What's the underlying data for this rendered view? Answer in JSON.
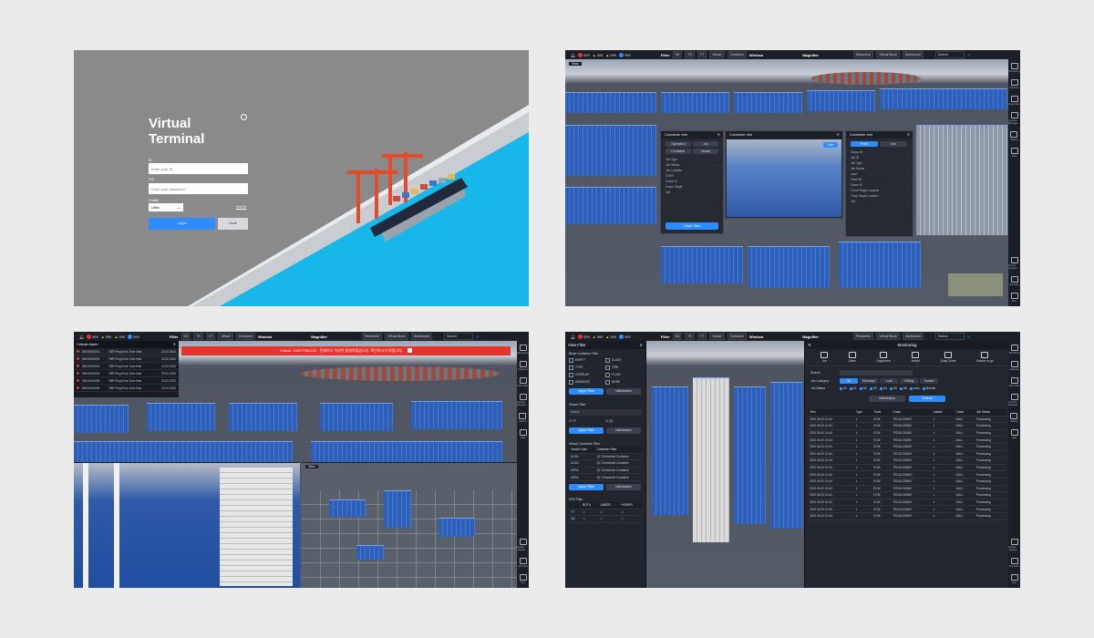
{
  "login": {
    "title_line1": "Virtual",
    "title_line2": "Terminal",
    "id_label": "ID",
    "id_placeholder": "Enter your ID",
    "pw_label": "PW",
    "pw_placeholder": "Enter your password",
    "quality_label": "Quality",
    "quality_value": "Ultra",
    "find_id": "Find ID",
    "login_button": "Log In",
    "close_button": "Close"
  },
  "toolbar": {
    "counts": [
      "999",
      "999",
      "999",
      "999"
    ],
    "filter_label": "Filter",
    "filter_items": [
      "SD",
      "TS",
      "YT"
    ],
    "vessel": "Vessel",
    "container": "Container",
    "window_label": "Window",
    "magnifier": "Magnifier",
    "right_items": [
      "Restorefor",
      "Virtual Block",
      "Dashboard"
    ],
    "search": "Search"
  },
  "sidebar": [
    "Monitoring",
    "Captures",
    "View Filter",
    "Camera Manager",
    "Setting",
    "Help",
    "Screen Capture",
    "Overview",
    "Exit"
  ],
  "panel2": {
    "view_label": "View",
    "dlg1": {
      "title": "Container Info",
      "tabs": [
        "Operation",
        "Job",
        "Container",
        "Vessel"
      ],
      "rows": [
        "Job Type",
        "Job Status",
        "Job Location",
        "CNTR",
        "Crane ID",
        "Crane Target",
        "Job"
      ],
      "button": "Driver View"
    },
    "dlg2": {
      "title": "Container Info",
      "button": "Live"
    },
    "dlg3": {
      "title": "Container Info",
      "tabs": [
        "Point",
        "Info"
      ],
      "rows": [
        "Group ID",
        "Job ID",
        "Job Type",
        "Job Status",
        "Lane",
        "Truck ID",
        "Crane ID",
        "Crane Target Location",
        "Truck Target Location",
        "Job"
      ]
    }
  },
  "panel3": {
    "alarm_title": "Critical Alarm",
    "alarms": [
      {
        "id": "DBG0000001",
        "msg": "TBR Ping Error Over time",
        "time": "22.02.2022"
      },
      {
        "id": "DBG0000002",
        "msg": "TBR Ping Error Over time",
        "time": "22.02.2022"
      },
      {
        "id": "DBG0000003",
        "msg": "TBR Ping Error Over time",
        "time": "22.02.2022"
      },
      {
        "id": "DBG0000004",
        "msg": "TBR Ping Error Over time",
        "time": "22.02.2022"
      },
      {
        "id": "DBG0000005",
        "msg": "TBR Ping Error Over time",
        "time": "22.02.2022"
      },
      {
        "id": "DBG0000006",
        "msg": "TBR Ping Error Over time",
        "time": "22.02.2022"
      }
    ],
    "banner": "Critical : DBVTR80222 - 컨테이너 이상이 발생하였습니다. 확인하시기 바랍니다."
  },
  "panel4": {
    "filter_title": "View Filter",
    "block_filter": "Block Container Filter",
    "block_items": [
      "EMPTY",
      "CLASS",
      "TYPE",
      "TIER",
      "OVERLAP",
      "FLOAT",
      "DAMAGED",
      "NONE"
    ],
    "apply": "Apply Filter",
    "init": "Initialization",
    "vessel_filter": "Vessel Filter",
    "vessel_select": "Select",
    "vessel_items": [
      "YT",
      "QC"
    ],
    "vcf_title": "Vessel Container Filter",
    "vcf_head": [
      "Vessel Code",
      "Container Filter"
    ],
    "vcf_rows": [
      [
        "ACAD",
        "QC Scheduled Container"
      ],
      [
        "ACAD",
        "QC Scheduled Container"
      ],
      [
        "AKRA",
        "QC Scheduled Container"
      ],
      [
        "AKRA",
        "QC Scheduled Container"
      ]
    ],
    "hpk_title": "HPK Filter",
    "hpk_cols": [
      "BOTH",
      "UNDER",
      "HIGHER"
    ],
    "hpk_rows": [
      "YT",
      "QC"
    ],
    "monitor_title": "Monitoring",
    "monitor_tabs": [
      "Job",
      "Alarm",
      "Equipment",
      "Vessel",
      "Quay Crane",
      "Monitor to go"
    ],
    "search_label": "Search",
    "job_category_label": "Job Category",
    "job_status_label": "Job Status",
    "categories": [
      "All",
      "Discharge",
      "Load",
      "Shifting",
      "Transfer"
    ],
    "statuses": [
      "All",
      "N1",
      "N2",
      "N3",
      "N4",
      "N5",
      "N6",
      "Auto",
      "Manual"
    ],
    "initialize": "Initialization",
    "search_button": "Search",
    "table_head": [
      "Time",
      "Type",
      "Truck",
      "Crane",
      "Ladder",
      "Crane",
      "Job Status"
    ],
    "rows": [
      [
        "2022.06.20 10:44",
        "L",
        "ECM",
        "TEDU1234567",
        "L",
        "NULL",
        "Processing"
      ],
      [
        "2022.06.20 10:44",
        "L",
        "ECM",
        "TEDU1234567",
        "L",
        "NULL",
        "Processing"
      ],
      [
        "2022.06.20 10:44",
        "L",
        "ECM",
        "TEDU1234567",
        "L",
        "NULL",
        "Processing"
      ],
      [
        "2022.06.20 10:44",
        "L",
        "ECM",
        "TEDU1234567",
        "L",
        "NULL",
        "Processing"
      ],
      [
        "2022.06.20 10:44",
        "L",
        "ECM",
        "TEDU1234567",
        "L",
        "NULL",
        "Processing"
      ],
      [
        "2022.06.20 10:44",
        "L",
        "ECM",
        "TEDU1234567",
        "L",
        "NULL",
        "Processing"
      ],
      [
        "2022.06.20 10:44",
        "L",
        "ECM",
        "TEDU1234567",
        "L",
        "NULL",
        "Processing"
      ],
      [
        "2022.06.20 10:44",
        "L",
        "ECM",
        "TEDU1234567",
        "L",
        "NULL",
        "Processing"
      ],
      [
        "2022.06.20 10:44",
        "L",
        "ECM",
        "TEDU1234567",
        "L",
        "NULL",
        "Processing"
      ],
      [
        "2022.06.20 10:44",
        "L",
        "ECM",
        "TEDU1234567",
        "L",
        "NULL",
        "Processing"
      ],
      [
        "2022.06.20 10:44",
        "L",
        "ECM",
        "TEDU1234567",
        "L",
        "NULL",
        "Processing"
      ],
      [
        "2022.06.20 10:44",
        "L",
        "ECM",
        "TEDU1234567",
        "L",
        "NULL",
        "Processing"
      ],
      [
        "2022.06.20 10:44",
        "L",
        "ECM",
        "TEDU1234567",
        "L",
        "NULL",
        "Processing"
      ],
      [
        "2022.06.20 10:44",
        "L",
        "ECM",
        "TEDU1234567",
        "L",
        "NULL",
        "Processing"
      ],
      [
        "2022.06.20 10:44",
        "L",
        "ECM",
        "TEDU1234567",
        "L",
        "NULL",
        "Processing"
      ]
    ]
  },
  "colors": {
    "accent": "#2f8cff",
    "sea": "#17b4e8",
    "panel_dark": "#1c1f25",
    "alarm_red": "#e3342f"
  }
}
